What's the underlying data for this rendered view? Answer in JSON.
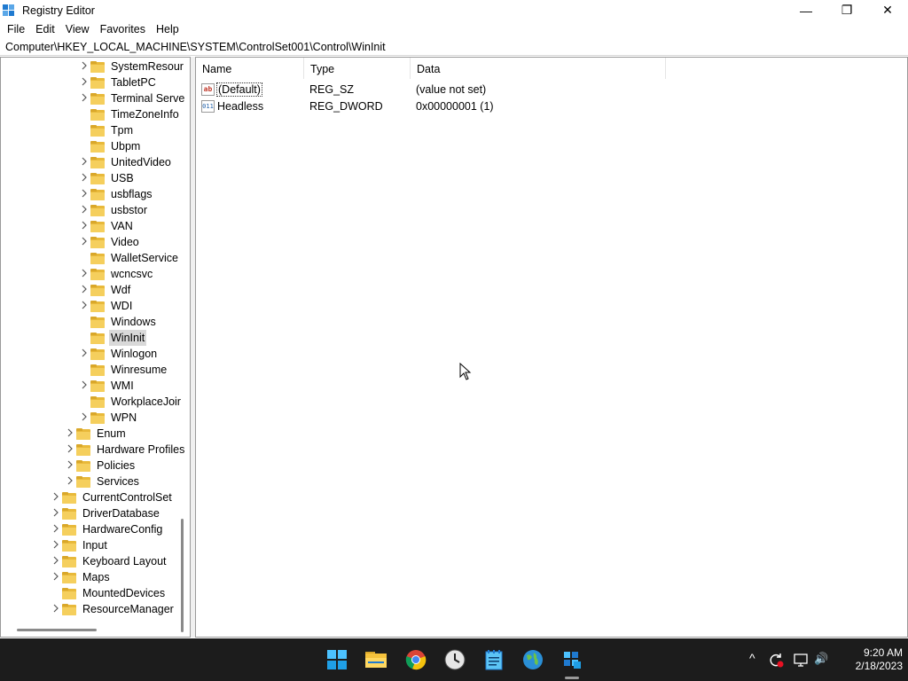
{
  "window": {
    "title": "Registry Editor",
    "minimize_glyph": "—",
    "restore_glyph": "❐",
    "close_glyph": "✕"
  },
  "menu": [
    "File",
    "Edit",
    "View",
    "Favorites",
    "Help"
  ],
  "address": "Computer\\HKEY_LOCAL_MACHINE\\SYSTEM\\ControlSet001\\Control\\WinInit",
  "tree": [
    {
      "label": "SystemResour",
      "level": 3,
      "expandable": true
    },
    {
      "label": "TabletPC",
      "level": 3,
      "expandable": true
    },
    {
      "label": "Terminal Serve",
      "level": 3,
      "expandable": true
    },
    {
      "label": "TimeZoneInfo",
      "level": 3,
      "expandable": false
    },
    {
      "label": "Tpm",
      "level": 3,
      "expandable": false
    },
    {
      "label": "Ubpm",
      "level": 3,
      "expandable": false
    },
    {
      "label": "UnitedVideo",
      "level": 3,
      "expandable": true
    },
    {
      "label": "USB",
      "level": 3,
      "expandable": true
    },
    {
      "label": "usbflags",
      "level": 3,
      "expandable": true
    },
    {
      "label": "usbstor",
      "level": 3,
      "expandable": true
    },
    {
      "label": "VAN",
      "level": 3,
      "expandable": true
    },
    {
      "label": "Video",
      "level": 3,
      "expandable": true
    },
    {
      "label": "WalletService",
      "level": 3,
      "expandable": false
    },
    {
      "label": "wcncsvc",
      "level": 3,
      "expandable": true
    },
    {
      "label": "Wdf",
      "level": 3,
      "expandable": true
    },
    {
      "label": "WDI",
      "level": 3,
      "expandable": true
    },
    {
      "label": "Windows",
      "level": 3,
      "expandable": false
    },
    {
      "label": "WinInit",
      "level": 3,
      "expandable": false,
      "selected": true
    },
    {
      "label": "Winlogon",
      "level": 3,
      "expandable": true
    },
    {
      "label": "Winresume",
      "level": 3,
      "expandable": false
    },
    {
      "label": "WMI",
      "level": 3,
      "expandable": true
    },
    {
      "label": "WorkplaceJoir",
      "level": 3,
      "expandable": false
    },
    {
      "label": "WPN",
      "level": 3,
      "expandable": true
    },
    {
      "label": "Enum",
      "level": 2,
      "expandable": true
    },
    {
      "label": "Hardware Profiles",
      "level": 2,
      "expandable": true
    },
    {
      "label": "Policies",
      "level": 2,
      "expandable": true
    },
    {
      "label": "Services",
      "level": 2,
      "expandable": true
    },
    {
      "label": "CurrentControlSet",
      "level": 1,
      "expandable": true
    },
    {
      "label": "DriverDatabase",
      "level": 1,
      "expandable": true
    },
    {
      "label": "HardwareConfig",
      "level": 1,
      "expandable": true
    },
    {
      "label": "Input",
      "level": 1,
      "expandable": true
    },
    {
      "label": "Keyboard Layout",
      "level": 1,
      "expandable": true
    },
    {
      "label": "Maps",
      "level": 1,
      "expandable": true
    },
    {
      "label": "MountedDevices",
      "level": 1,
      "expandable": false
    },
    {
      "label": "ResourceManager",
      "level": 1,
      "expandable": true
    }
  ],
  "list": {
    "columns": [
      "Name",
      "Type",
      "Data"
    ],
    "rows": [
      {
        "name": "(Default)",
        "type": "REG_SZ",
        "data": "(value not set)",
        "icon": "string-value-icon",
        "icon_text": "ab"
      },
      {
        "name": "Headless",
        "type": "REG_DWORD",
        "data": "0x00000001 (1)",
        "icon": "binary-value-icon",
        "icon_text": "011"
      }
    ]
  },
  "taskbar": {
    "apps": [
      "start-icon",
      "file-explorer-icon",
      "chrome-icon",
      "clock-app-icon",
      "notepad-icon",
      "globe-app-icon",
      "registry-editor-icon"
    ],
    "tray": [
      "chevron-up-icon",
      "sync-icon",
      "network-icon",
      "volume-icon"
    ],
    "tray_glyphs": {
      "chevron": "^",
      "volume": "🔊"
    },
    "time": "9:20 AM",
    "date": "2/18/2023"
  },
  "colors": {
    "folder": "#f5cf5d",
    "taskbar": "#1c1c1c",
    "selection": "#d9d9d9"
  }
}
